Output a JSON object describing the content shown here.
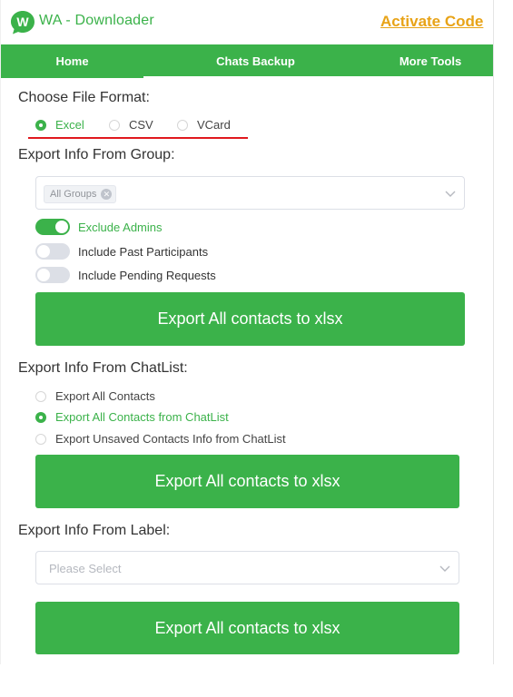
{
  "header": {
    "app_title": "WA - Downloader",
    "activate_label": "Activate Code",
    "logo_letter": "W"
  },
  "nav": {
    "tabs": [
      "Home",
      "Chats Backup",
      "More Tools"
    ],
    "active": "Home"
  },
  "file_format": {
    "label": "Choose File Format:",
    "options": [
      "Excel",
      "CSV",
      "VCard"
    ],
    "selected": "Excel"
  },
  "group": {
    "label": "Export Info From Group:",
    "tag": "All Groups",
    "switches": [
      {
        "label": "Exclude Admins",
        "on": true
      },
      {
        "label": "Include Past Participants",
        "on": false
      },
      {
        "label": "Include Pending Requests",
        "on": false
      }
    ],
    "button": "Export All contacts to xlsx"
  },
  "chatlist": {
    "label": "Export Info From ChatList:",
    "options": [
      "Export All Contacts",
      "Export All Contacts from ChatList",
      "Export Unsaved Contacts Info from ChatList"
    ],
    "selected": "Export All Contacts from ChatList",
    "button": "Export All contacts to xlsx"
  },
  "label_section": {
    "label": "Export Info From Label:",
    "placeholder": "Please Select",
    "button": "Export All contacts to xlsx"
  },
  "colors": {
    "accent": "#3bb24a",
    "activate": "#e8a317",
    "underline": "#e0191e"
  }
}
